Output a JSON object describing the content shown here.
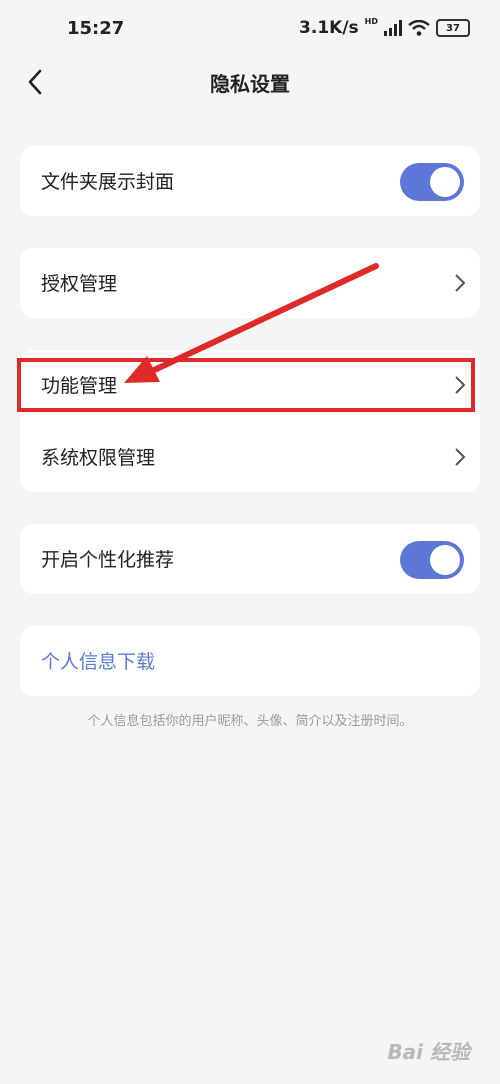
{
  "status_bar": {
    "time": "15:27",
    "net_speed": "3.1K/s",
    "network_badge": "HD",
    "battery": "37",
    "icons": [
      "signal-icon",
      "wifi-icon",
      "battery-icon"
    ]
  },
  "header": {
    "title": "隐私设置",
    "back_icon": "chevron-left-icon"
  },
  "settings": {
    "folder_cover": {
      "label": "文件夹展示封面",
      "enabled": true
    },
    "auth_manage": {
      "label": "授权管理"
    },
    "feature_manage": {
      "label": "功能管理"
    },
    "system_permission": {
      "label": "系统权限管理"
    },
    "personalized": {
      "label": "开启个性化推荐",
      "enabled": true
    },
    "download_info": {
      "label": "个人信息下载"
    },
    "footnote": "个人信息包括你的用户昵称、头像、简介以及注册时间。"
  },
  "annotation": {
    "highlight_color": "#e02a2a",
    "target": "功能管理"
  },
  "colors": {
    "accent": "#5c77d6",
    "link": "#5a7bd0",
    "background": "#f5f5f5"
  },
  "watermark": "Bai 经验"
}
